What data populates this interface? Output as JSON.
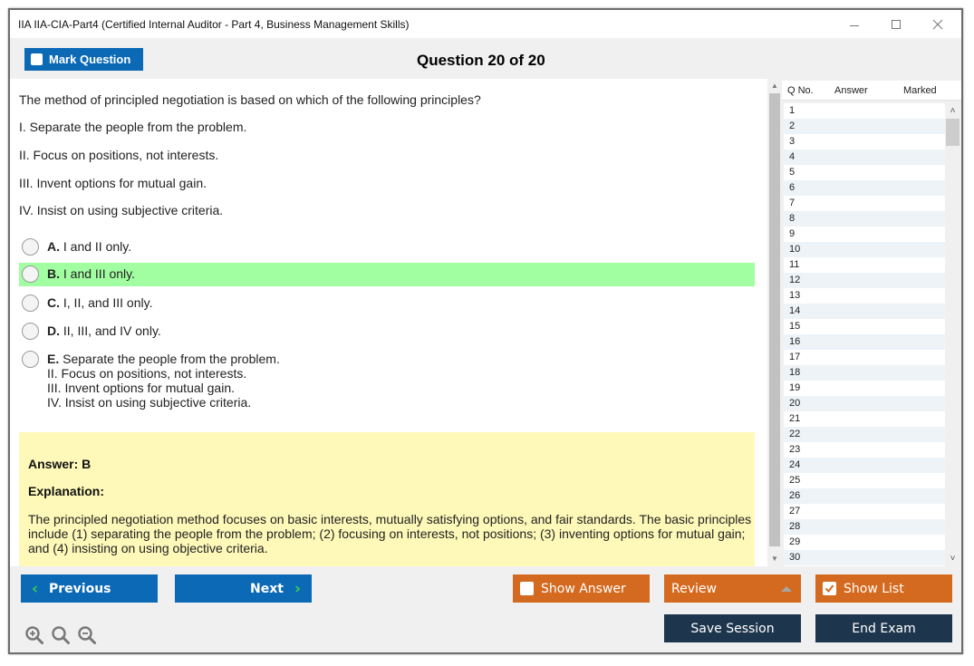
{
  "window": {
    "title": "IIA IIA-CIA-Part4 (Certified Internal Auditor - Part 4, Business Management Skills)",
    "controls": [
      "minimize-icon",
      "maximize-icon",
      "close-icon"
    ]
  },
  "toolbar": {
    "mark_question_label": "Mark Question",
    "mark_question_checked": false,
    "question_counter": "Question 20 of 20"
  },
  "question": {
    "stem": "The method of principled negotiation is based on which of the following principles?",
    "statements": [
      "I. Separate the people from the problem.",
      "II. Focus on positions, not interests.",
      "III. Invent options for mutual gain.",
      "IV. Insist on using subjective criteria."
    ],
    "options": [
      {
        "letter": "A.",
        "text": "I and II only.",
        "highlighted": false
      },
      {
        "letter": "B.",
        "text": "I and III only.",
        "highlighted": true
      },
      {
        "letter": "C.",
        "text": "I, II, and III only.",
        "highlighted": false
      },
      {
        "letter": "D.",
        "text": "II, III, and IV only.",
        "highlighted": false
      },
      {
        "letter": "E.",
        "text": "Separate the people from the problem.",
        "extra_lines": [
          "II. Focus on positions, not interests.",
          "III. Invent options for mutual gain.",
          "IV. Insist on using subjective criteria."
        ],
        "highlighted": false
      }
    ],
    "highlight_color": "#a1fea1"
  },
  "answer": {
    "answer_label": "Answer: B",
    "explanation_label": "Explanation:",
    "explanation_text": "The principled negotiation method focuses on basic interests, mutually satisfying options, and fair standards. The basic principles include (1) separating the people from the problem; (2) focusing on interests, not positions; (3) inventing options for mutual gain; and (4) insisting on using objective criteria.",
    "background_color": "#fef9b8"
  },
  "question_list": {
    "columns": [
      "Q No.",
      "Answer",
      "Marked"
    ],
    "rows": [
      "1",
      "2",
      "3",
      "4",
      "5",
      "6",
      "7",
      "8",
      "9",
      "10",
      "11",
      "12",
      "13",
      "14",
      "15",
      "16",
      "17",
      "18",
      "19",
      "20",
      "21",
      "22",
      "23",
      "24",
      "25",
      "26",
      "27",
      "28",
      "29",
      "30"
    ]
  },
  "buttons": {
    "previous": "Previous",
    "next": "Next",
    "show_answer": "Show Answer",
    "show_answer_checked": false,
    "review": "Review",
    "show_list": "Show List",
    "show_list_checked": true,
    "save_session": "Save Session",
    "end_exam": "End Exam"
  },
  "zoom_controls": [
    "zoom-in-icon",
    "zoom-reset-icon",
    "zoom-out-icon"
  ],
  "colors": {
    "primary_blue": "#0b69b5",
    "orange": "#d46a20",
    "navy": "#1e364d",
    "chevron_green": "#3ad04a"
  }
}
